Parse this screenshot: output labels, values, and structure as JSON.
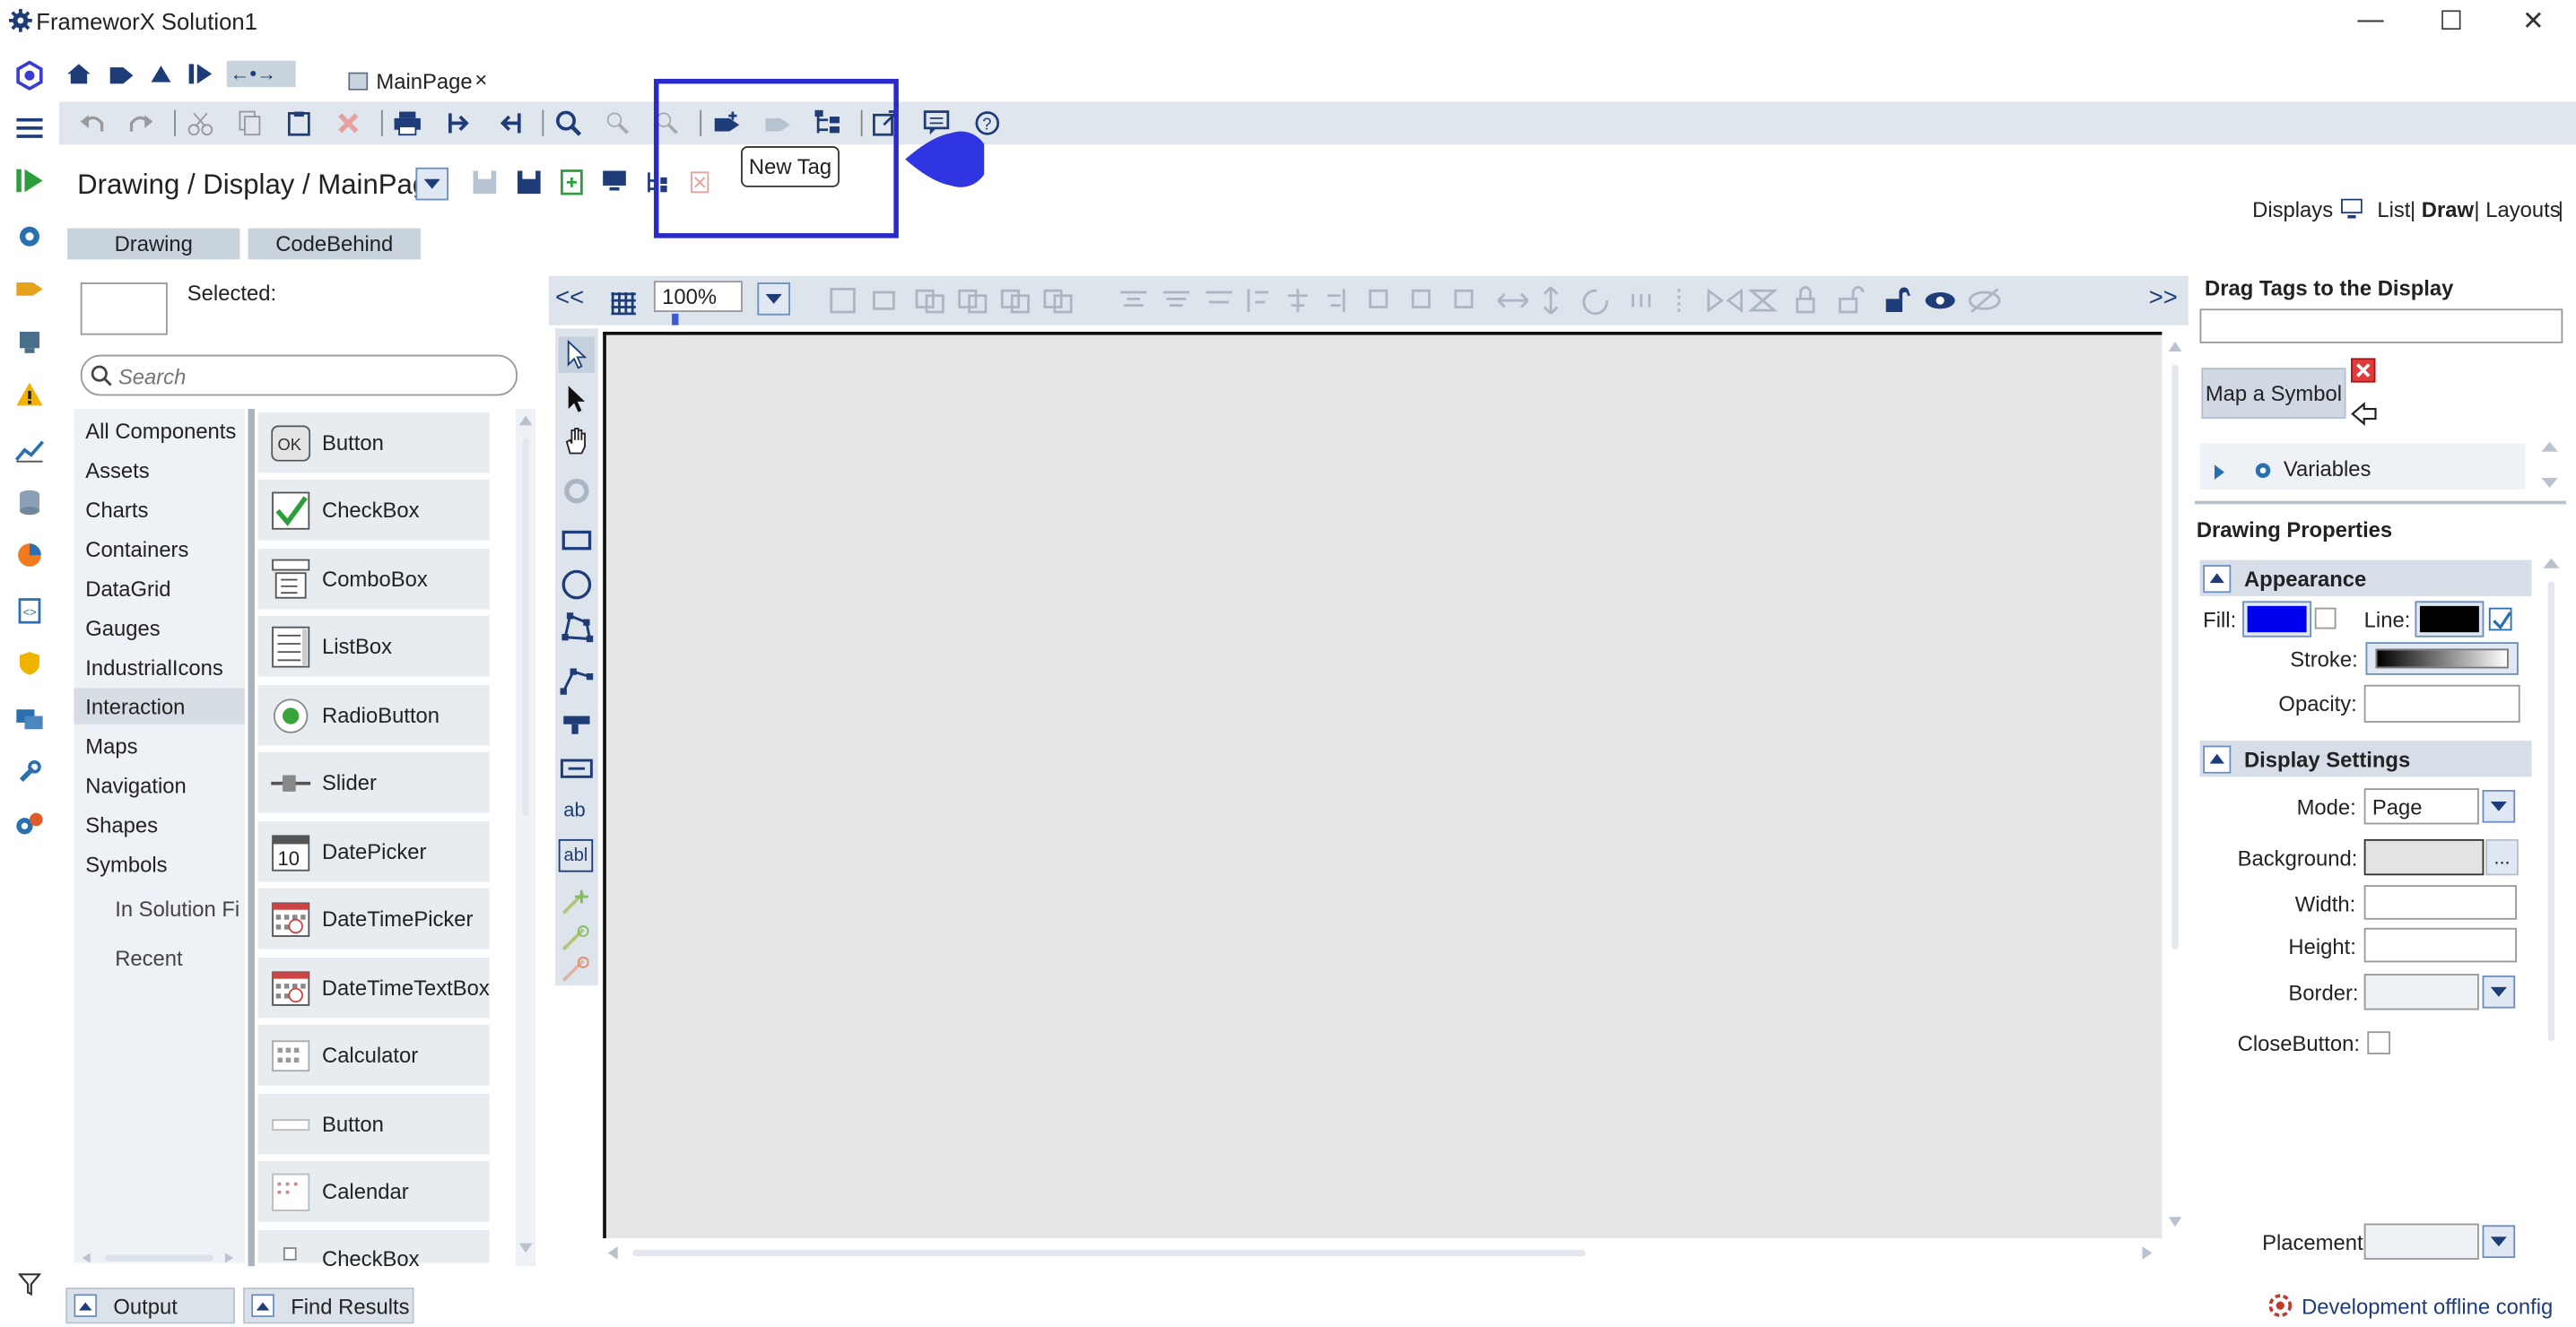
{
  "window": {
    "title": "FrameworX Solution1"
  },
  "doc_tab": {
    "label": "MainPage"
  },
  "tooltip": {
    "text": "New Tag"
  },
  "breadcrumb": {
    "text": "Drawing / Display / MainPage"
  },
  "view_switch": {
    "label": "Displays",
    "list": "List",
    "sep": "|",
    "draw": "Draw",
    "layouts": "Layouts"
  },
  "sub_tabs": {
    "drawing": "Drawing",
    "codebehind": "CodeBehind"
  },
  "components": {
    "selected_label": "Selected:",
    "search_placeholder": "Search",
    "categories": [
      "All Components",
      "Assets",
      "Charts",
      "Containers",
      "DataGrid",
      "Gauges",
      "IndustrialIcons",
      "Interaction",
      "Maps",
      "Navigation",
      "Shapes",
      "Symbols"
    ],
    "sub_categories": [
      "In Solution Fi",
      "Recent"
    ],
    "selected_category": "Interaction",
    "items": [
      "Button",
      "CheckBox",
      "ComboBox",
      "ListBox",
      "RadioButton",
      "Slider",
      "DatePicker",
      "DateTimePicker",
      "DateTimeTextBox",
      "Calculator",
      "Button",
      "Calendar",
      "CheckBox"
    ]
  },
  "canvas_bar": {
    "collapse_left": "<<",
    "zoom": "100%",
    "expand_right": ">>"
  },
  "vtools": {
    "text_label": "ab",
    "textbox_label": "abl"
  },
  "right": {
    "drag_title": "Drag Tags to the Display",
    "map_symbol": "Map a Symbol",
    "variables": "Variables",
    "drawing_props": "Drawing Properties",
    "appearance": "Appearance",
    "fill_label": "Fill:",
    "line_label": "Line:",
    "stroke_label": "Stroke:",
    "opacity_label": "Opacity:",
    "display_settings": "Display Settings",
    "mode_label": "Mode:",
    "mode_value": "Page",
    "background_label": "Background:",
    "background_more": "...",
    "width_label": "Width:",
    "height_label": "Height:",
    "border_label": "Border:",
    "closebutton_label": "CloseButton:",
    "placement_label": "Placement:",
    "colors": {
      "fill": "#0000ee",
      "line": "#000000"
    }
  },
  "bottom": {
    "output": "Output",
    "find_results": "Find Results",
    "status": "Development offline config"
  }
}
